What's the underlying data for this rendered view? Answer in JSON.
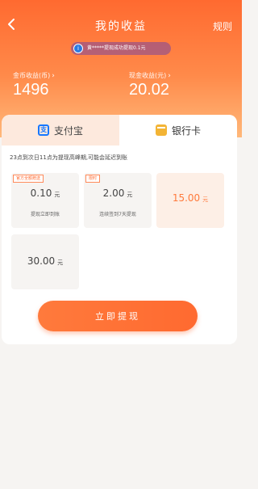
{
  "header": {
    "title": "我的收益",
    "rules_label": "规则",
    "notice_text": "黄*****提现成功提现0.1元",
    "coin_income_label": "金币收益(币)",
    "coin_income_value": "1496",
    "cash_income_label": "现金收益(元)",
    "cash_income_value": "20.02"
  },
  "tabs": [
    {
      "label": "支付宝",
      "icon": "alipay-icon"
    },
    {
      "label": "银行卡",
      "icon": "bank-card-icon"
    }
  ],
  "note": "23点到次日11点为提现高峰期,可能会延迟到账",
  "options": [
    {
      "tag": "官方全额赠送",
      "amount": "0.10",
      "unit": "元",
      "sub": "提现立即到账"
    },
    {
      "tag": "限时",
      "amount": "2.00",
      "unit": "元",
      "sub": "连续签到7天提现"
    },
    {
      "tag": "",
      "amount": "15.00",
      "unit": "元",
      "sub": ""
    },
    {
      "tag": "",
      "amount": "30.00",
      "unit": "元",
      "sub": ""
    }
  ],
  "cta_label": "立即提现",
  "colors": {
    "accent": "#ff6a30",
    "selected_bg": "#fdefe6",
    "bank_icon": "#f3b435",
    "alipay_icon": "#1677ff"
  }
}
